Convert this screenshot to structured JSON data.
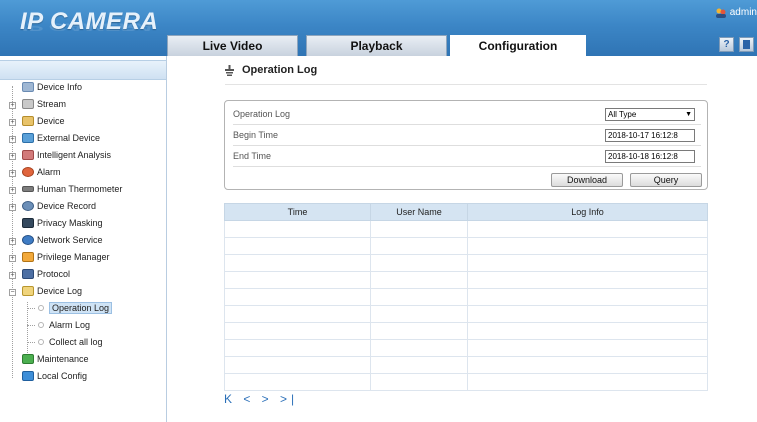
{
  "header": {
    "logo": "IP CAMERA",
    "tabs": [
      {
        "label": "Live Video"
      },
      {
        "label": "Playback"
      },
      {
        "label": "Configuration"
      }
    ],
    "user": "admin"
  },
  "sidebar": {
    "items": [
      {
        "label": "Device Info"
      },
      {
        "label": "Stream"
      },
      {
        "label": "Device"
      },
      {
        "label": "External Device"
      },
      {
        "label": "Intelligent Analysis"
      },
      {
        "label": "Alarm"
      },
      {
        "label": "Human Thermometer"
      },
      {
        "label": "Device Record"
      },
      {
        "label": "Privacy Masking"
      },
      {
        "label": "Network Service"
      },
      {
        "label": "Privilege Manager"
      },
      {
        "label": "Protocol"
      },
      {
        "label": "Device Log"
      },
      {
        "label": "Operation Log"
      },
      {
        "label": "Alarm Log"
      },
      {
        "label": "Collect all log"
      },
      {
        "label": "Maintenance"
      },
      {
        "label": "Local Config"
      }
    ]
  },
  "main": {
    "title": "Operation Log",
    "filter": {
      "operation_log_label": "Operation Log",
      "operation_log_value": "All Type",
      "begin_time_label": "Begin Time",
      "begin_time_value": "2018-10-17 16:12:8",
      "end_time_label": "End Time",
      "end_time_value": "2018-10-18 16:12:8",
      "download_label": "Download",
      "query_label": "Query"
    },
    "table": {
      "columns": [
        "Time",
        "User Name",
        "Log Info"
      ]
    },
    "pager": "K < > >|"
  }
}
